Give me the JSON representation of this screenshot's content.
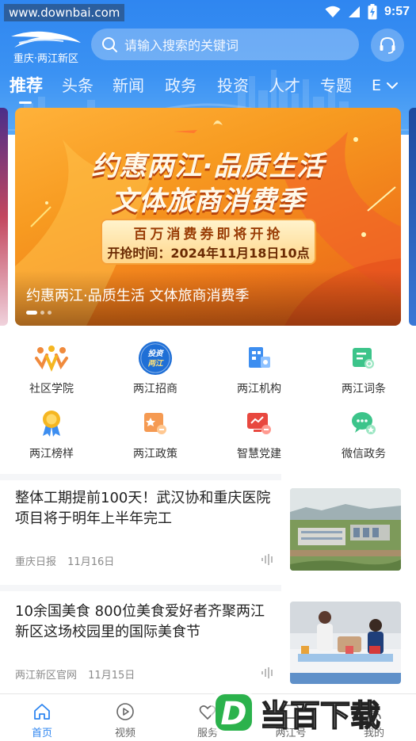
{
  "status_bar": {
    "watermark_url": "www.downbai.com",
    "time": "9:57"
  },
  "header": {
    "logo_text": "重庆·两江新区",
    "search_placeholder": "请输入搜索的关键词",
    "service_icon": "headset-icon"
  },
  "tabs": [
    {
      "label": "推荐",
      "active": true
    },
    {
      "label": "头条"
    },
    {
      "label": "新闻"
    },
    {
      "label": "政务"
    },
    {
      "label": "投资"
    },
    {
      "label": "人才"
    },
    {
      "label": "专题"
    }
  ],
  "tabs_more_label": "E",
  "banner": {
    "title_line1": "约惠两江·品质生活",
    "title_line2": "文体旅商消费季",
    "plate_line1": "百万消费券即将开抢",
    "plate_line2": "开抢时间：2024年11月18日10点",
    "caption": "约惠两江·品质生活 文体旅商消费季",
    "page_count": 3,
    "active_page": 1
  },
  "grid": [
    {
      "label": "社区学院",
      "icon": "community-college-icon",
      "color": "#f08a3c"
    },
    {
      "label": "两江招商",
      "icon": "investment-badge-icon",
      "color": "#1f6fd6",
      "badge_line1": "投资",
      "badge_line2": "两江"
    },
    {
      "label": "两江机构",
      "icon": "organization-icon",
      "color": "#3d8ef0"
    },
    {
      "label": "两江词条",
      "icon": "glossary-icon",
      "color": "#3cc48a"
    },
    {
      "label": "两江榜样",
      "icon": "medal-icon",
      "color": "#f5b621"
    },
    {
      "label": "两江政策",
      "icon": "policy-icon",
      "color": "#f59a52"
    },
    {
      "label": "智慧党建",
      "icon": "party-building-icon",
      "color": "#e8483f"
    },
    {
      "label": "微信政务",
      "icon": "wechat-icon",
      "color": "#3cc48a"
    }
  ],
  "news": [
    {
      "title": "整体工期提前100天！武汉协和重庆医院项目将于明年上半年完工",
      "source": "重庆日报",
      "date": "11月16日"
    },
    {
      "title": "10余国美食 800位美食爱好者齐聚两江新区这场校园里的国际美食节",
      "source": "两江新区官网",
      "date": "11月15日"
    }
  ],
  "bottom_nav": [
    {
      "label": "首页",
      "icon": "home-icon",
      "active": true
    },
    {
      "label": "视频",
      "icon": "video-play-icon"
    },
    {
      "label": "服务",
      "icon": "service-icon"
    },
    {
      "label": "两江号",
      "icon": "channel-icon"
    },
    {
      "label": "我的",
      "icon": "profile-icon"
    }
  ],
  "watermark_logo": {
    "letter": "D",
    "text": "当百下载"
  }
}
